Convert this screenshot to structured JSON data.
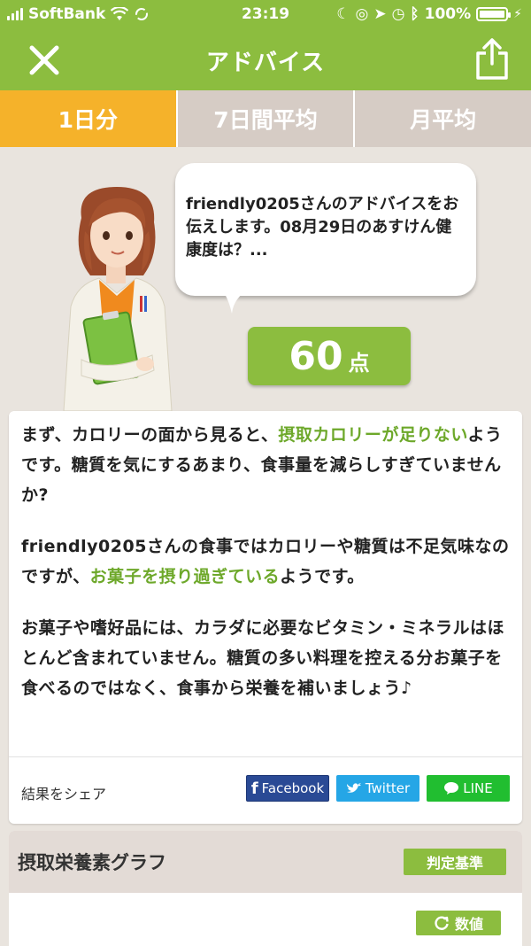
{
  "status_bar": {
    "carrier": "SoftBank",
    "time": "23:19",
    "battery_percent": "100%",
    "battery_level": 1.0
  },
  "nav": {
    "title": "アドバイス"
  },
  "tabs": [
    {
      "label": "1日分",
      "active": true
    },
    {
      "label": "7日間平均",
      "active": false
    },
    {
      "label": "月平均",
      "active": false
    }
  ],
  "hero": {
    "bubble_text": "friendly0205さんのアドバイスをお伝えします。08月29日のあすけん健康度は？...",
    "score_value": "60",
    "score_unit": "点"
  },
  "advice": {
    "p1": {
      "a": "まず、カロリーの面から見ると、",
      "b": "摂取カロリーが足りない",
      "c": "ようです。糖質を気にするあまり、食事量を減らしすぎていませんか?"
    },
    "p2": {
      "a": "friendly0205さんの食事ではカロリーや糖質は不足気味なのですが、",
      "b": "お菓子を摂り過ぎている",
      "c": "ようです。"
    },
    "p3": "お菓子や嗜好品には、カラダに必要なビタミン・ミネラルはほとんど含まれていません。糖質の多い料理を控える分お菓子を食べるのではなく、食事から栄養を補いましょう♪",
    "share_label": "結果をシェア",
    "share_buttons": {
      "facebook": "Facebook",
      "twitter": "Twitter",
      "line": "LINE"
    }
  },
  "graph": {
    "title": "摂取栄養素グラフ",
    "criteria_button": "判定基準",
    "values_button": "数値"
  },
  "colors": {
    "brand_green": "#8cbd3f",
    "active_tab": "#f5b22a",
    "inactive_tab": "#d6ccc5",
    "highlight": "#6da82a"
  }
}
